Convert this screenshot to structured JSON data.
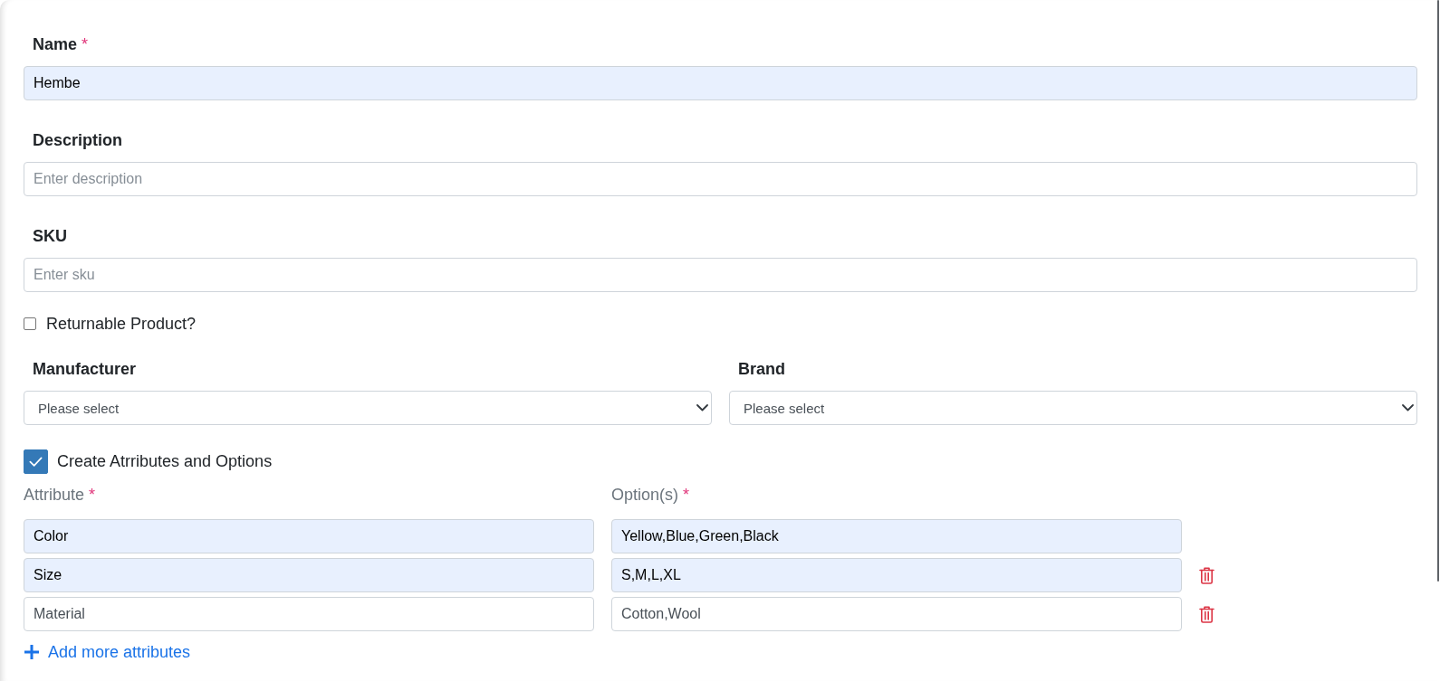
{
  "fields": [
    {
      "label": "Name",
      "required_mark": "*",
      "value": "Hembe",
      "autofilled": true
    },
    {
      "label": "Description",
      "placeholder": "Enter description",
      "autofilled": false
    },
    {
      "label": "SKU",
      "placeholder": "Enter sku",
      "autofilled": false
    }
  ],
  "returnable": {
    "label": "Returnable Product?",
    "checked": false
  },
  "selects": [
    {
      "label": "Manufacturer",
      "value": "Please select"
    },
    {
      "label": "Brand",
      "value": "Please select"
    }
  ],
  "attributes_toggle": {
    "label": "Create Atrributes and Options",
    "checked": true
  },
  "attributes": {
    "columns": [
      {
        "label": "Attribute",
        "required_mark": "*"
      },
      {
        "label": "Option(s)",
        "required_mark": "*"
      }
    ],
    "rows": [
      {
        "attribute": "Color",
        "options": "Yellow,Blue,Green,Black",
        "autofilled": true,
        "removable": false
      },
      {
        "attribute": "Size",
        "options": "S,M,L,XL",
        "autofilled": true,
        "removable": true
      },
      {
        "attribute": "Material",
        "options": "Cotton,Wool",
        "autofilled": false,
        "removable": true
      }
    ]
  },
  "add_link": {
    "label": "Add more attributes"
  }
}
